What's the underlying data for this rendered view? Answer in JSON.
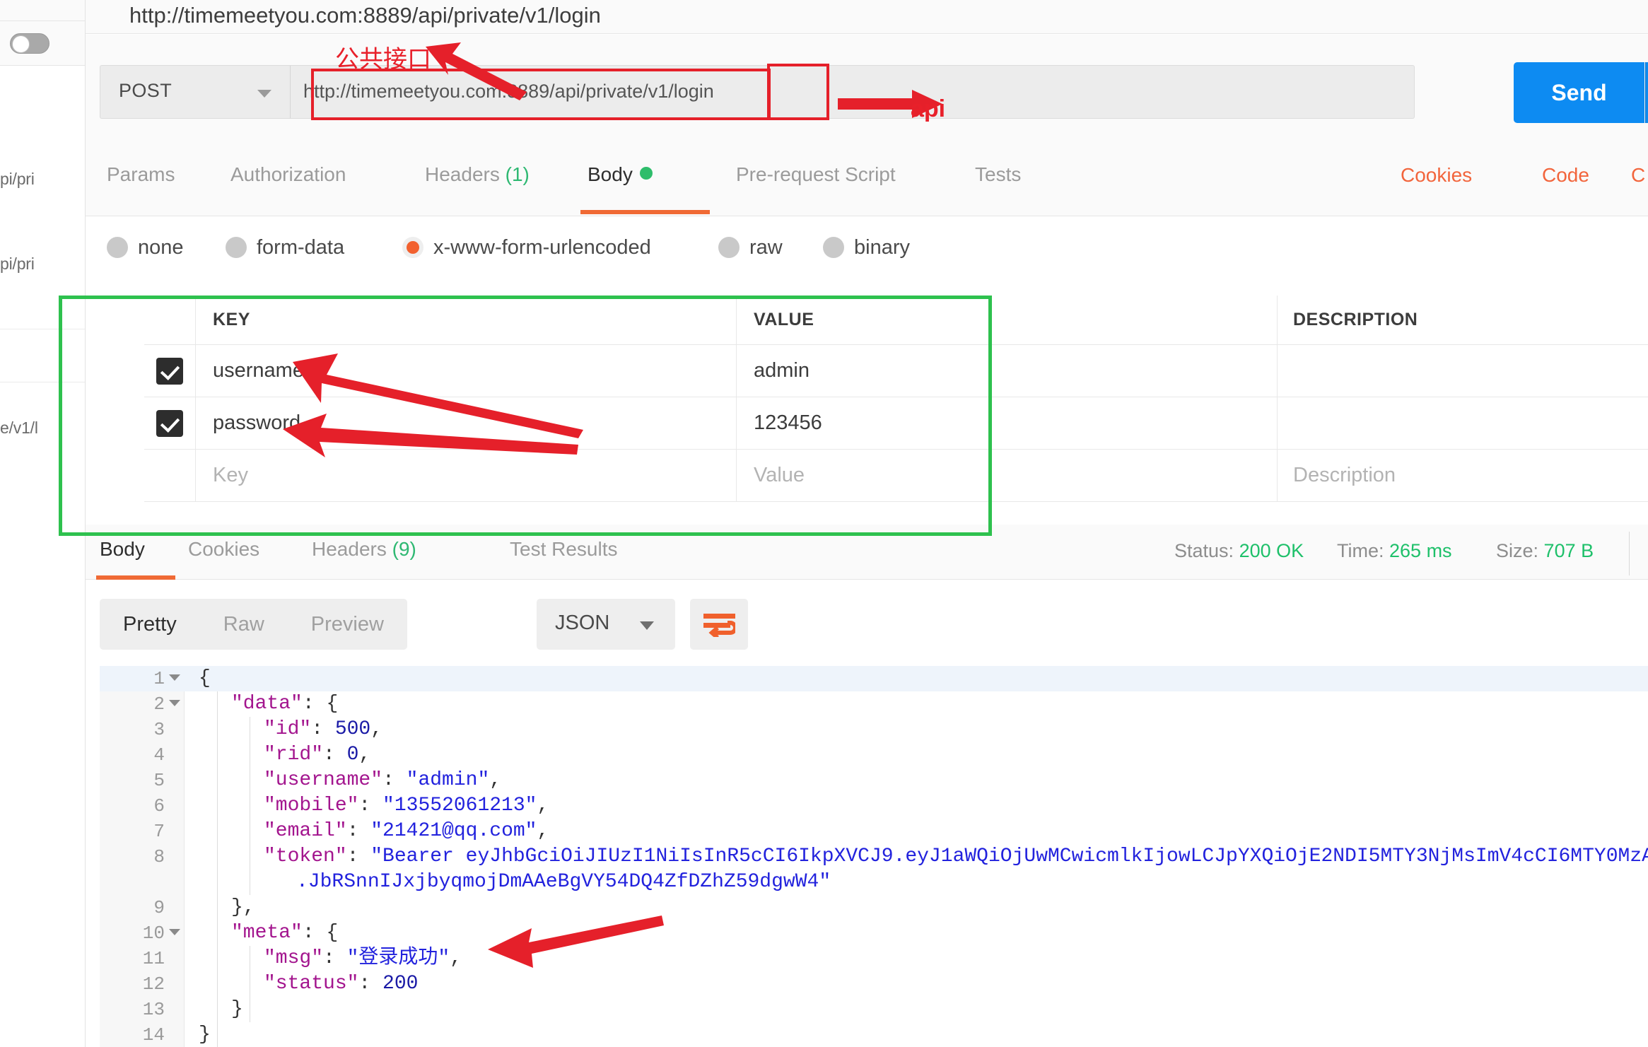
{
  "sidebar": {
    "toggle_state": "off",
    "entries": [
      "pi/pri",
      "pi/pri",
      "e/v1/l"
    ]
  },
  "request": {
    "title": "http://timemeetyou.com:8889/api/private/v1/login",
    "method": "POST",
    "url": "http://timemeetyou.com:8889/api/private/v1/login",
    "send_label": "Send"
  },
  "request_tabs": [
    {
      "label": "Params",
      "active": false
    },
    {
      "label": "Authorization",
      "active": false
    },
    {
      "label": "Headers",
      "count": "(1)",
      "active": false
    },
    {
      "label": "Body",
      "active": true,
      "dot": true
    },
    {
      "label": "Pre-request Script",
      "active": false
    },
    {
      "label": "Tests",
      "active": false
    }
  ],
  "top_right_links": [
    "Cookies",
    "Code"
  ],
  "body_types": [
    {
      "label": "none",
      "selected": false
    },
    {
      "label": "form-data",
      "selected": false
    },
    {
      "label": "x-www-form-urlencoded",
      "selected": true
    },
    {
      "label": "raw",
      "selected": false
    },
    {
      "label": "binary",
      "selected": false
    }
  ],
  "kv_table": {
    "headers": [
      "KEY",
      "VALUE",
      "DESCRIPTION"
    ],
    "more_icon": "ellipsis-icon",
    "rows": [
      {
        "checked": true,
        "key": "username",
        "value": "admin",
        "description": ""
      },
      {
        "checked": true,
        "key": "password",
        "value": "123456",
        "description": ""
      }
    ],
    "placeholder_row": {
      "key": "Key",
      "value": "Value",
      "description": "Description"
    }
  },
  "response_tabs": [
    {
      "label": "Body",
      "active": true
    },
    {
      "label": "Cookies",
      "active": false
    },
    {
      "label": "Headers",
      "count": "(9)",
      "active": false
    },
    {
      "label": "Test Results",
      "active": false
    }
  ],
  "response_meta": {
    "status_label": "Status:",
    "status_value": "200 OK",
    "time_label": "Time:",
    "time_value": "265 ms",
    "size_label": "Size:",
    "size_value": "707 B"
  },
  "response_toolbar": {
    "views": [
      {
        "label": "Pretty",
        "active": true
      },
      {
        "label": "Raw",
        "active": false
      },
      {
        "label": "Preview",
        "active": false
      }
    ],
    "format": "JSON",
    "wrap_icon": "wrap-lines-icon"
  },
  "code": {
    "lines": [
      {
        "n": "1",
        "fold": true,
        "indent": 0,
        "text": "{"
      },
      {
        "n": "2",
        "fold": true,
        "indent": 1,
        "text": "\"data\": {"
      },
      {
        "n": "3",
        "fold": false,
        "indent": 2,
        "text": "\"id\": 500,"
      },
      {
        "n": "4",
        "fold": false,
        "indent": 2,
        "text": "\"rid\": 0,"
      },
      {
        "n": "5",
        "fold": false,
        "indent": 2,
        "text": "\"username\": \"admin\","
      },
      {
        "n": "6",
        "fold": false,
        "indent": 2,
        "text": "\"mobile\": \"13552061213\","
      },
      {
        "n": "7",
        "fold": false,
        "indent": 2,
        "text": "\"email\": \"21421@qq.com\","
      },
      {
        "n": "8",
        "fold": false,
        "indent": 2,
        "text": "\"token\": \"Bearer eyJhbGciOiJIUzI1NiIsInR5cCI6IkpXVCJ9.eyJ1aWQiOjUwMCwicmlkIjowLCJpYXQiOjE2NDI5MTY3NjMsImV4cCI6MTY0MzA"
      },
      {
        "n": "",
        "fold": false,
        "indent": 3,
        "text": ".JbRSnnIJxjbyqmojDmAAeBgVY54DQ4ZfDZhZ59dgwW4\""
      },
      {
        "n": "9",
        "fold": false,
        "indent": 1,
        "text": "},"
      },
      {
        "n": "10",
        "fold": true,
        "indent": 1,
        "text": "\"meta\": {"
      },
      {
        "n": "11",
        "fold": false,
        "indent": 2,
        "text": "\"msg\": \"登录成功\","
      },
      {
        "n": "12",
        "fold": false,
        "indent": 2,
        "text": "\"status\": 200"
      },
      {
        "n": "13",
        "fold": false,
        "indent": 1,
        "text": "}"
      },
      {
        "n": "14",
        "fold": false,
        "indent": 0,
        "text": "}"
      }
    ]
  },
  "annotations": {
    "public_api_label": "公共接口",
    "api_label": "api"
  },
  "colors": {
    "accent_orange": "#f06a35",
    "send_blue": "#0d8bf2",
    "status_green": "#1ec06a",
    "annotation_red": "#e5202a",
    "annotation_green": "#2ec14e"
  }
}
